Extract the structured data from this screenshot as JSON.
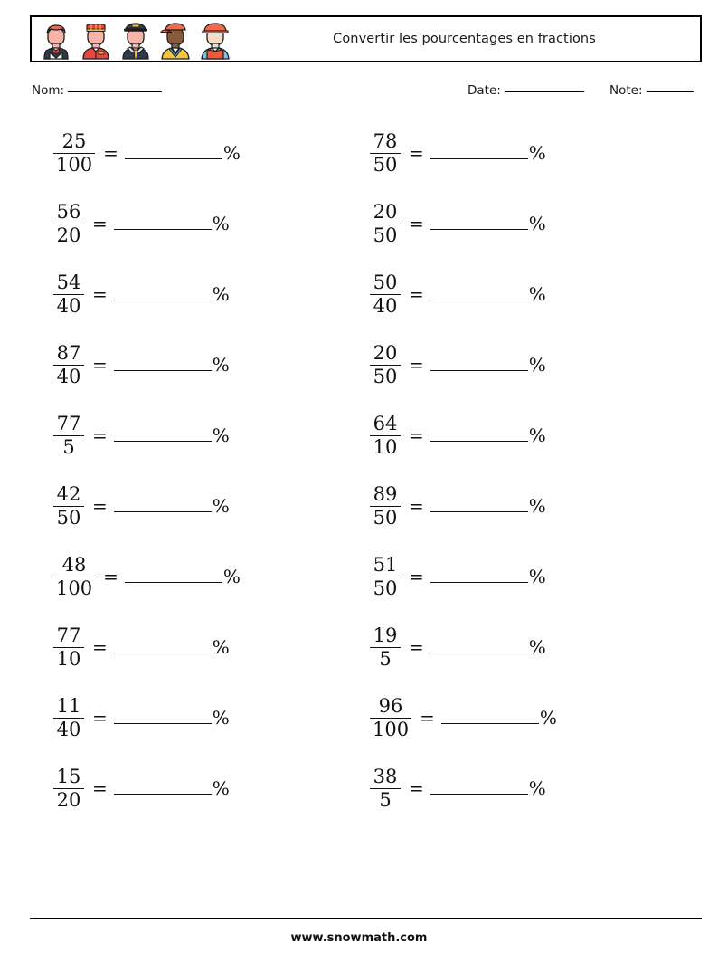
{
  "header": {
    "title": "Convertir les pourcentages en fractions",
    "avatars": [
      {
        "name": "avatar-waiter-icon",
        "skin": "#f9b3a8",
        "hair": "#f0694a",
        "garment": "#2f3a4a",
        "accent": "#e8453c",
        "shirt": "#ffffff"
      },
      {
        "name": "avatar-bellhop-icon",
        "skin": "#f9b3a8",
        "hair": "#e8453c",
        "garment": "#e8453c",
        "accent": "#f5b942",
        "shirt": "#e8453c"
      },
      {
        "name": "avatar-police-icon",
        "skin": "#f9b3a8",
        "hair": "#2f3a4a",
        "garment": "#2f3a4a",
        "accent": "#f5b942",
        "shirt": "#dfe6ee"
      },
      {
        "name": "avatar-athlete-icon",
        "skin": "#8a5a3c",
        "hair": "#f0694a",
        "garment": "#f5c33b",
        "accent": "#4da3d8",
        "shirt": "#f5c33b"
      },
      {
        "name": "avatar-construction-icon",
        "skin": "#f3ddc4",
        "hair": "#f0694a",
        "garment": "#f05a36",
        "accent": "#7fc0e8",
        "shirt": "#7fc0e8"
      }
    ]
  },
  "meta": {
    "name_label": "Nom:",
    "date_label": "Date:",
    "note_label": "Note:"
  },
  "problems": {
    "equals": "=",
    "percent": "%",
    "left": [
      {
        "index": 1,
        "numerator": "25",
        "denominator": "100"
      },
      {
        "index": 2,
        "numerator": "56",
        "denominator": "20"
      },
      {
        "index": 3,
        "numerator": "54",
        "denominator": "40"
      },
      {
        "index": 4,
        "numerator": "87",
        "denominator": "40"
      },
      {
        "index": 5,
        "numerator": "77",
        "denominator": "5"
      },
      {
        "index": 6,
        "numerator": "42",
        "denominator": "50"
      },
      {
        "index": 7,
        "numerator": "48",
        "denominator": "100"
      },
      {
        "index": 8,
        "numerator": "77",
        "denominator": "10"
      },
      {
        "index": 9,
        "numerator": "11",
        "denominator": "40"
      },
      {
        "index": 10,
        "numerator": "15",
        "denominator": "20"
      }
    ],
    "right": [
      {
        "index": 11,
        "numerator": "78",
        "denominator": "50"
      },
      {
        "index": 12,
        "numerator": "20",
        "denominator": "50"
      },
      {
        "index": 13,
        "numerator": "50",
        "denominator": "40"
      },
      {
        "index": 14,
        "numerator": "20",
        "denominator": "50"
      },
      {
        "index": 15,
        "numerator": "64",
        "denominator": "10"
      },
      {
        "index": 16,
        "numerator": "89",
        "denominator": "50"
      },
      {
        "index": 17,
        "numerator": "51",
        "denominator": "50"
      },
      {
        "index": 18,
        "numerator": "19",
        "denominator": "5"
      },
      {
        "index": 19,
        "numerator": "96",
        "denominator": "100"
      },
      {
        "index": 20,
        "numerator": "38",
        "denominator": "5"
      }
    ]
  },
  "footer": {
    "site": "www.snowmath.com"
  }
}
